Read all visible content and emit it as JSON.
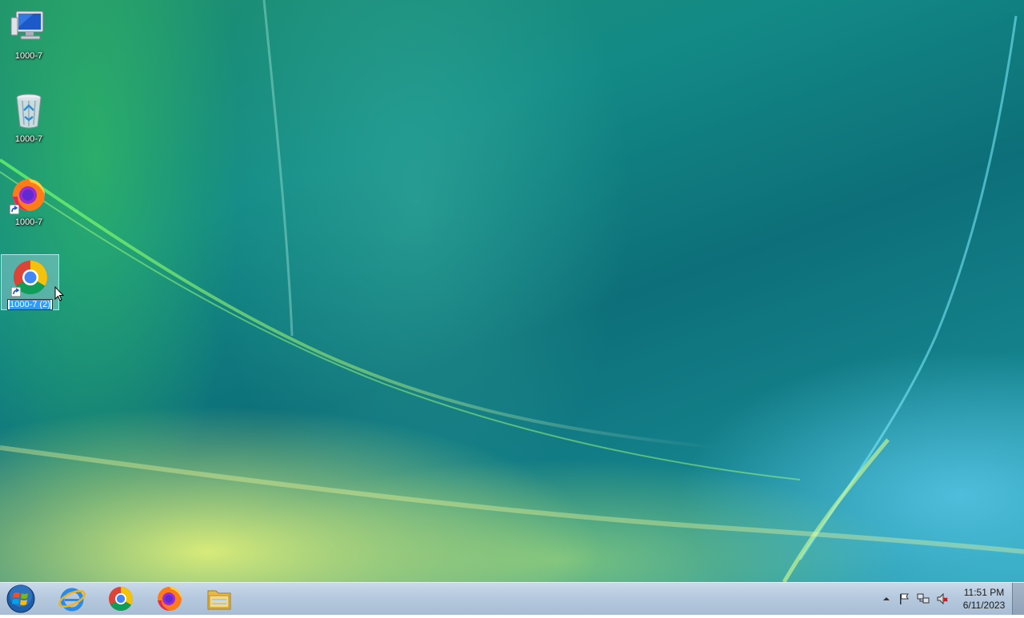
{
  "desktop": {
    "icons": [
      {
        "name": "computer",
        "label": "1000-7"
      },
      {
        "name": "recycle-bin",
        "label": "1000-7"
      },
      {
        "name": "firefox-shortcut",
        "label": "1000-7"
      },
      {
        "name": "chrome-shortcut",
        "label": "1000-7 (2)",
        "state": "renaming"
      }
    ]
  },
  "taskbar": {
    "pinned": [
      {
        "name": "internet-explorer",
        "icon": "internet-explorer-icon"
      },
      {
        "name": "google-chrome",
        "icon": "chrome-icon"
      },
      {
        "name": "firefox",
        "icon": "firefox-icon"
      },
      {
        "name": "file-explorer",
        "icon": "folder-icon"
      }
    ],
    "clock": {
      "time": "11:51 PM",
      "date": "6/11/2023"
    }
  },
  "colors": {
    "selection": "#3399ff",
    "taskbar": "#b6c9de"
  }
}
